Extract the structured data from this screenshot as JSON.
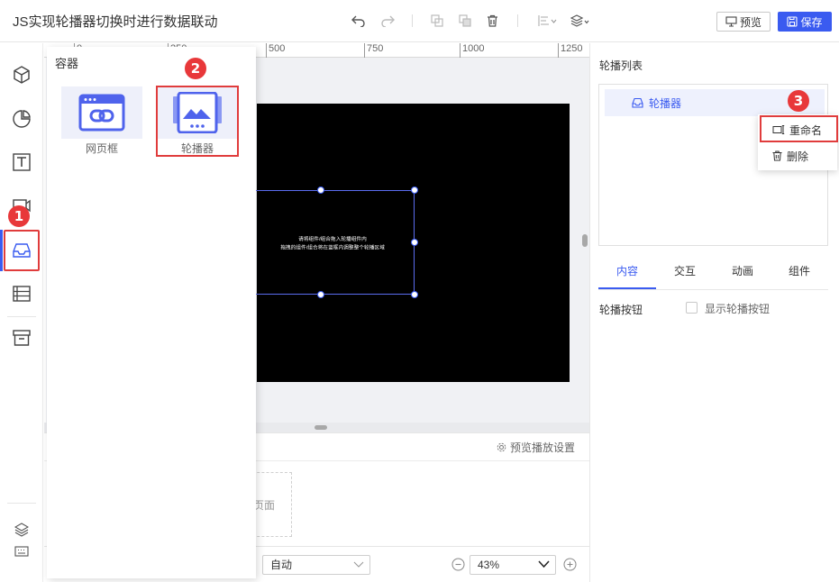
{
  "header": {
    "title": "JS实现轮播器切换时进行数据联动",
    "preview_label": "预览",
    "save_label": "保存"
  },
  "ruler": {
    "ticks": [
      "0",
      "250",
      "500",
      "750",
      "1000",
      "1250"
    ]
  },
  "flyout": {
    "title": "容器",
    "components": [
      {
        "label": "网页框",
        "icon": "link-frame-icon"
      },
      {
        "label": "轮播器",
        "icon": "carousel-image-icon"
      }
    ]
  },
  "canvas": {
    "placeholder_line1": "请将组件/组合拖入轮播组件内",
    "placeholder_line2": "拖拽的组件/组合将在蓝框内调整整个轮播区域"
  },
  "page_panel": {
    "preview_settings": "预览播放设置",
    "add_page_label": "页面"
  },
  "bottom_bar": {
    "size_mode": "自动",
    "zoom": "43%"
  },
  "right_panel": {
    "title": "轮播列表",
    "items": [
      {
        "label": "轮播器"
      }
    ],
    "tabs": [
      {
        "label": "内容",
        "active": true
      },
      {
        "label": "交互",
        "active": false
      },
      {
        "label": "动画",
        "active": false
      },
      {
        "label": "组件",
        "active": false
      }
    ],
    "property_label": "轮播按钮",
    "checkbox_label": "显示轮播按钮"
  },
  "context_menu": {
    "items": [
      {
        "label": "重命名",
        "icon": "rename-icon"
      },
      {
        "label": "删除",
        "icon": "trash-icon"
      }
    ]
  },
  "steps": [
    "1",
    "2",
    "3"
  ],
  "colors": {
    "accent": "#3a5bf0",
    "highlight_red": "#e03c3c",
    "step_badge": "#e8383a",
    "stage_bg": "#000000"
  }
}
